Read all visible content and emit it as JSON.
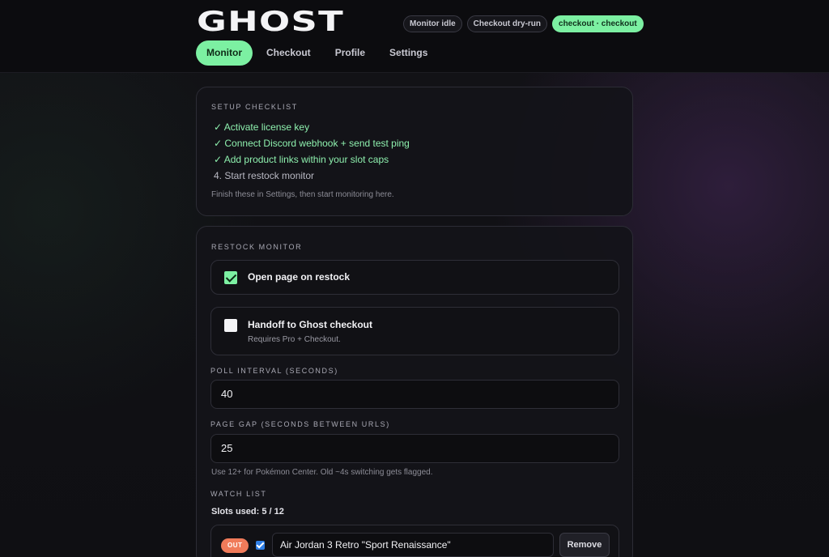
{
  "app": {
    "logo": "GHOST"
  },
  "status_pills": [
    {
      "label": "Monitor idle"
    },
    {
      "label": "Checkout dry-run"
    },
    {
      "label": "checkout · checkout"
    }
  ],
  "tabs": [
    {
      "label": "Monitor"
    },
    {
      "label": "Checkout"
    },
    {
      "label": "Profile"
    },
    {
      "label": "Settings"
    }
  ],
  "setup": {
    "title": "SETUP CHECKLIST",
    "items": [
      {
        "label": "✓ Activate license key"
      },
      {
        "label": "✓ Connect Discord webhook + send test ping"
      },
      {
        "label": "✓ Add product links within your slot caps"
      },
      {
        "label": "4. Start restock monitor"
      }
    ],
    "hint": "Finish these in Settings, then start monitoring here."
  },
  "restock": {
    "title": "RESTOCK MONITOR",
    "open_page": {
      "label": "Open page on restock"
    },
    "handoff": {
      "label": "Handoff to Ghost checkout",
      "sub": "Requires Pro + Checkout."
    },
    "poll_label": "POLL INTERVAL (SECONDS)",
    "poll_value": "40",
    "gap_label": "PAGE GAP (SECONDS BETWEEN URLS)",
    "gap_value": "25",
    "gap_hint": "Use 12+ for Pokémon Center. Old ~4s switching gets flagged.",
    "watch_label": "WATCH LIST",
    "slots": "Slots used: 5 / 12",
    "watch_items": [
      {
        "status": "OUT",
        "name": "Air Jordan 3 Retro \"Sport Renaissance\"",
        "remove": "Remove"
      }
    ]
  },
  "colors": {
    "accent": "#7cf0a2",
    "out_badge": "#f07b5a"
  }
}
